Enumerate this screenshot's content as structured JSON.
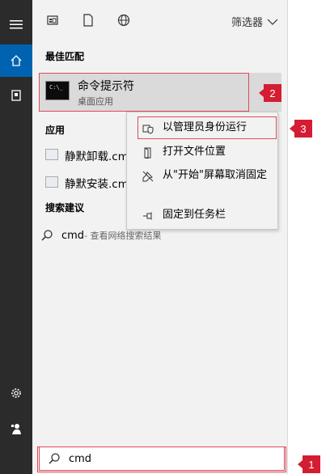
{
  "toolbar": {
    "filter_label": "筛选器"
  },
  "best_match": {
    "heading": "最佳匹配",
    "title": "命令提示符",
    "subtitle": "桌面应用",
    "icon_text": "C:\\_"
  },
  "apps": {
    "heading": "应用",
    "items": [
      {
        "label": "静默卸载.cmd"
      },
      {
        "label": "静默安装.cmd"
      }
    ]
  },
  "suggestions": {
    "heading": "搜索建议",
    "items": [
      {
        "query": "cmd",
        "suffix": " - 查看网络搜索结果"
      }
    ]
  },
  "search": {
    "value": "cmd"
  },
  "context_menu": {
    "items": [
      {
        "label": "以管理员身份运行",
        "icon": "shield-icon"
      },
      {
        "label": "打开文件位置",
        "icon": "folder-open-icon"
      },
      {
        "label": "从\"开始\"屏幕取消固定",
        "icon": "unpin-icon"
      },
      {
        "label": "固定到任务栏",
        "icon": "pin-icon"
      }
    ]
  },
  "annotations": {
    "badge1": "1",
    "badge2": "2",
    "badge3": "3"
  },
  "colors": {
    "accent": "#0063b1",
    "annotation": "#d41d32",
    "rail": "#2b2b2b"
  }
}
